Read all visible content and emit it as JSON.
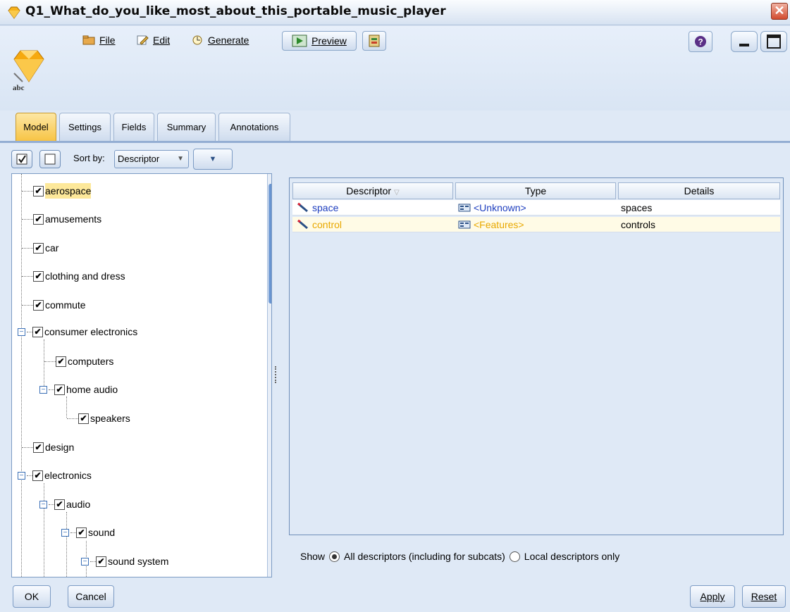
{
  "window": {
    "title": "Q1_What_do_you_like_most_about_this_portable_music_player",
    "close_glyph": "✕"
  },
  "toolbar": {
    "file_label": "File",
    "edit_label": "Edit",
    "generate_label": "Generate",
    "preview_label": "Preview",
    "logo_text": "abc"
  },
  "tabs": [
    {
      "label": "Model",
      "active": true
    },
    {
      "label": "Settings"
    },
    {
      "label": "Fields"
    },
    {
      "label": "Summary"
    },
    {
      "label": "Annotations"
    }
  ],
  "sortbar": {
    "label": "Sort by:",
    "value": "Descriptor"
  },
  "tree": {
    "items": [
      {
        "label": "aerospace",
        "checked": true,
        "selected": true
      },
      {
        "label": "amusements",
        "checked": true
      },
      {
        "label": "car",
        "checked": true
      },
      {
        "label": "clothing and dress",
        "checked": true
      },
      {
        "label": "commute",
        "checked": true
      },
      {
        "label": "consumer electronics",
        "checked": true,
        "expanded": true
      },
      {
        "label": "computers",
        "checked": true
      },
      {
        "label": "home audio",
        "checked": true,
        "expanded": true
      },
      {
        "label": "speakers",
        "checked": true
      },
      {
        "label": "design",
        "checked": true
      },
      {
        "label": "electronics",
        "checked": true,
        "expanded": true
      },
      {
        "label": "audio",
        "checked": true,
        "expanded": true
      },
      {
        "label": "sound",
        "checked": true,
        "expanded": true
      },
      {
        "label": "sound system",
        "checked": true,
        "expanded": true
      }
    ]
  },
  "table": {
    "columns": [
      "Descriptor",
      "Type",
      "Details"
    ],
    "rows": [
      {
        "descriptor": "space",
        "type": "<Unknown>",
        "details": "spaces",
        "color": "#1f3fbf"
      },
      {
        "descriptor": "control",
        "type": "<Features>",
        "details": "controls",
        "color": "#e8a800"
      }
    ]
  },
  "show": {
    "label": "Show",
    "option_all": "All descriptors (including for subcats)",
    "option_local": "Local descriptors only",
    "selected": "all"
  },
  "buttons": {
    "ok": "OK",
    "cancel": "Cancel",
    "apply": "Apply",
    "reset": "Reset"
  },
  "colors": {
    "accent": "#f7c445",
    "window_bg": "#dfe9f6",
    "unknown_type": "#1f3fbf",
    "features_type": "#e8a800"
  }
}
